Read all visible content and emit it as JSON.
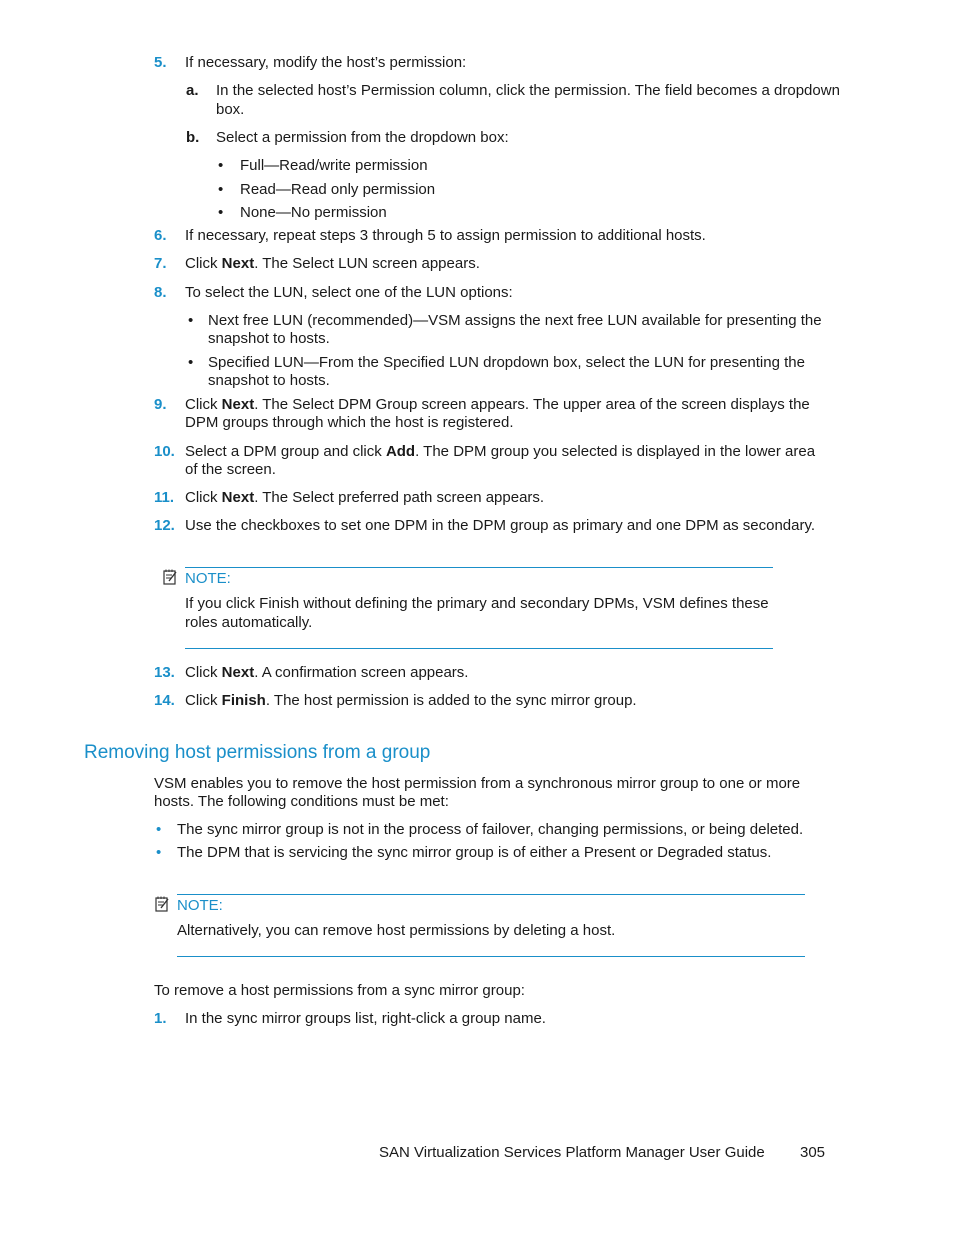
{
  "steps_a": [
    {
      "num": "5.",
      "text": "If necessary, modify the host’s permission:"
    }
  ],
  "substep_a": {
    "label": "a.",
    "line1": "In the selected host’s Permission column, click the permission. The field becomes a dropdown",
    "line2": "box."
  },
  "substep_b": {
    "label": "b.",
    "text": "Select a permission from the dropdown box:"
  },
  "permissions": [
    "Full—Read/write permission",
    "Read—Read only permission",
    "None—No permission"
  ],
  "step6": {
    "num": "6.",
    "text": "If necessary, repeat steps 3 through 5 to assign permission to additional hosts."
  },
  "step7": {
    "num": "7.",
    "pre": "Click ",
    "bold": "Next",
    "post": ". The Select LUN screen appears."
  },
  "step8": {
    "num": "8.",
    "text": "To select the LUN, select one of the LUN options:"
  },
  "lun_options": [
    {
      "line1": "Next free LUN (recommended)—VSM assigns the next free LUN available for presenting the",
      "line2": "snapshot to hosts."
    },
    {
      "line1": "Specified LUN—From the Specified LUN dropdown box, select the LUN for presenting the",
      "line2": "snapshot to hosts."
    }
  ],
  "step9": {
    "num": "9.",
    "pre": "Click ",
    "bold": "Next",
    "post": ". The Select DPM Group screen appears. The upper area of the screen displays the",
    "line2": "DPM groups through which the host is registered."
  },
  "step10": {
    "num": "10.",
    "pre": "Select a DPM group and click ",
    "bold": "Add",
    "post": ". The DPM group you selected is displayed in the lower area",
    "line2": "of the screen."
  },
  "step11": {
    "num": "11.",
    "pre": "Click ",
    "bold": "Next",
    "post": ". The Select preferred path screen appears."
  },
  "step12": {
    "num": "12.",
    "text": "Use the checkboxes to set one DPM in the DPM group as primary and one DPM as secondary."
  },
  "note1": {
    "label": "NOTE:",
    "line1": "If you click Finish without defining the primary and secondary DPMs, VSM defines these",
    "line2": "roles automatically."
  },
  "step13": {
    "num": "13.",
    "pre": "Click ",
    "bold": "Next",
    "post": ". A confirmation screen appears."
  },
  "step14": {
    "num": "14.",
    "pre": "Click ",
    "bold": "Finish",
    "post": ". The host permission is added to the sync mirror group."
  },
  "section": {
    "heading": "Removing host permissions from a group",
    "intro_line1": "VSM enables you to remove the host permission from a synchronous mirror group to one or more",
    "intro_line2": "hosts. The following conditions must be met:",
    "conditions": [
      "The sync mirror group is not in the process of failover, changing permissions, or being deleted.",
      "The DPM that is servicing the sync mirror group is of either a Present or Degraded status."
    ],
    "note": {
      "label": "NOTE:",
      "text": "Alternatively, you can remove host permissions by deleting a host."
    },
    "procedure_intro": "To remove a host permissions from a sync mirror group:",
    "step1": {
      "num": "1.",
      "text": "In the sync mirror groups list, right-click a group name."
    }
  },
  "footer": {
    "title": "SAN Virtualization Services Platform Manager User Guide",
    "page": "305"
  },
  "colors": {
    "accent": "#1a8fc9",
    "text": "#1a1a1a"
  }
}
